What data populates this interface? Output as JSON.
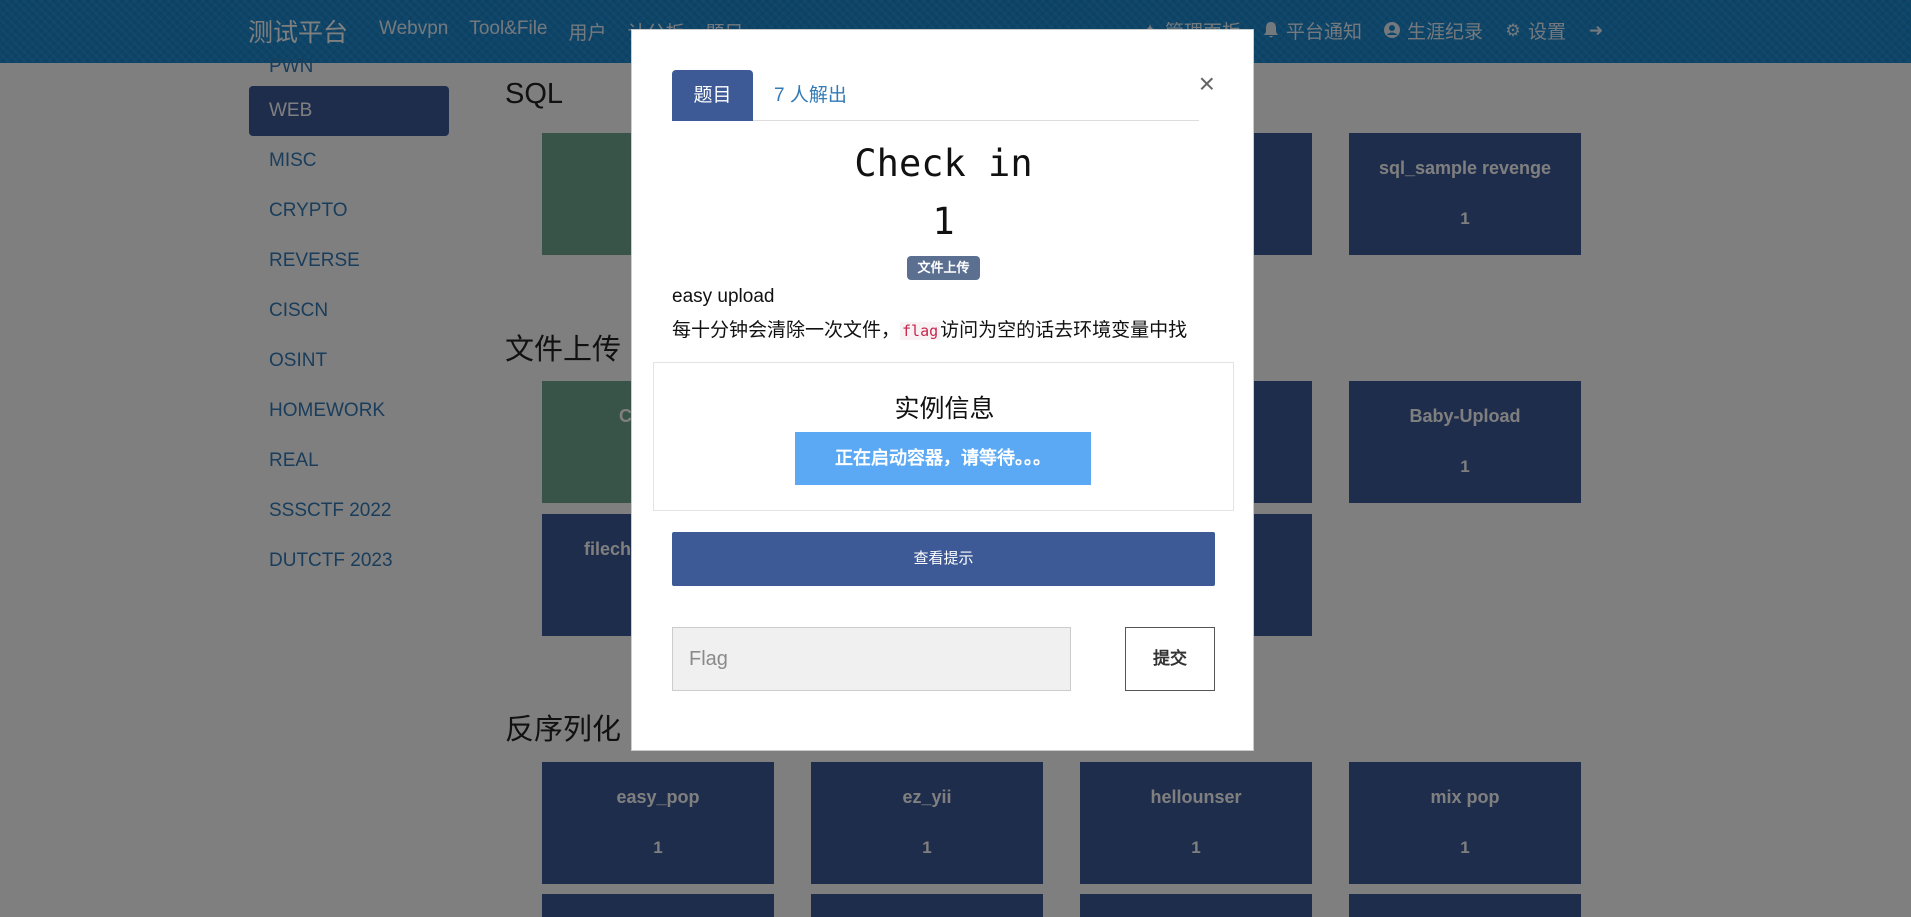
{
  "navbar": {
    "brand": "测试平台",
    "left_items": [
      "Webvpn",
      "Tool&File",
      "用户",
      "计分板",
      "题目"
    ],
    "right_items": [
      {
        "icon": "wrench-icon",
        "glyph": "✦",
        "label": "管理面板"
      },
      {
        "icon": "bell-icon",
        "glyph": "🔔",
        "label": "平台通知"
      },
      {
        "icon": "user-circle-icon",
        "glyph": "●",
        "label": "生涯纪录"
      },
      {
        "icon": "gears-icon",
        "glyph": "⚙",
        "label": "设置"
      },
      {
        "icon": "logout-icon",
        "glyph": "➜",
        "label": ""
      }
    ]
  },
  "sidebar": {
    "items": [
      "PWN",
      "WEB",
      "MISC",
      "CRYPTO",
      "REVERSE",
      "CISCN",
      "OSINT",
      "HOMEWORK",
      "REAL",
      "SSSCTF 2022",
      "DUTCTF 2023"
    ],
    "active": "WEB"
  },
  "sections": {
    "sql": {
      "title": "SQL",
      "card4": {
        "name": "sql_sample revenge",
        "score": "1"
      }
    },
    "upload": {
      "title": "文件上传",
      "card1_partial": "C",
      "card4": {
        "name": "Baby-Upload",
        "score": "1"
      },
      "row2_card1_partial": "filech"
    },
    "unserialize": {
      "title": "反序列化",
      "cards": [
        {
          "name": "easy_pop",
          "score": "1"
        },
        {
          "name": "ez_yii",
          "score": "1"
        },
        {
          "name": "hellounser",
          "score": "1"
        },
        {
          "name": "mix pop",
          "score": "1"
        }
      ]
    }
  },
  "modal": {
    "tab_challenge": "题目",
    "tab_solves": "7 人解出",
    "close": "×",
    "name": "Check in",
    "score": "1",
    "tag": "文件上传",
    "desc_line1": "easy upload",
    "desc_line2_before": "每十分钟会清除一次文件，",
    "desc_line2_code": "flag",
    "desc_line2_after": "访问为空的话去环境变量中找",
    "instance_title": "实例信息",
    "instance_status": "正在启动容器，请等待。。。",
    "hint_button": "查看提示",
    "flag_placeholder": "Flag",
    "submit_button": "提交"
  },
  "colors": {
    "navbar": "#1b8ad3",
    "card": "#3d5a96",
    "card_solved": "#70a991",
    "instance_button": "#5ba9f5"
  }
}
